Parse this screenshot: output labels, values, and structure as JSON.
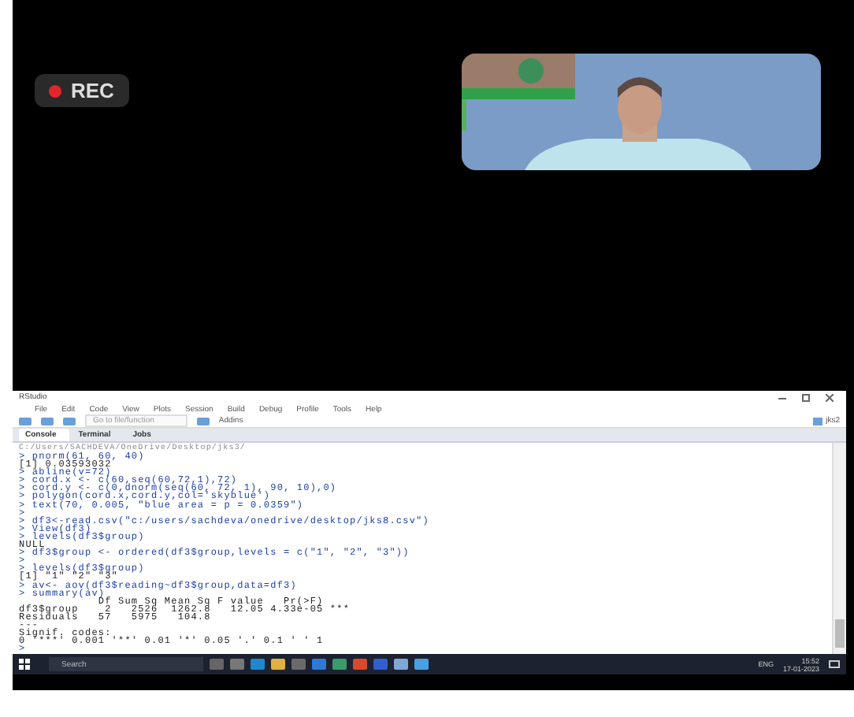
{
  "recording": {
    "label": "REC"
  },
  "shared_screen": {
    "window_title": "RStudio",
    "menu": [
      "File",
      "Edit",
      "Code",
      "View",
      "Plots",
      "Session",
      "Build",
      "Debug",
      "Profile",
      "Tools",
      "Help"
    ],
    "toolbar": {
      "goto_placeholder": "Go to file/function",
      "addins": "Addins",
      "project": "jks2"
    },
    "tabs": [
      {
        "label": "Console",
        "selected": true
      },
      {
        "label": "Terminal",
        "selected": false
      },
      {
        "label": "Jobs",
        "selected": false
      }
    ],
    "console_path": "C:/Users/SACHDEVA/OneDrive/Desktop/jks3/",
    "console_lines": [
      {
        "kind": "input",
        "text": "> pnorm(61, 60, 40)"
      },
      {
        "kind": "output",
        "text": "[1] 0.03593032"
      },
      {
        "kind": "input",
        "text": "> abline(v=72)"
      },
      {
        "kind": "input",
        "text": "> cord.x <- c(60,seq(60,72,1),72)"
      },
      {
        "kind": "input",
        "text": "> cord.y <- c(0,dnorm(seq(60, 72, 1), 90, 10),0)"
      },
      {
        "kind": "input",
        "text": "> polygon(cord.x,cord.y,col='skyblue')"
      },
      {
        "kind": "input",
        "text": "> text(70, 0.005, \"blue area = p = 0.0359\")"
      },
      {
        "kind": "input",
        "text": ">"
      },
      {
        "kind": "input",
        "text": "> df3<-read.csv(\"c:/users/sachdeva/onedrive/desktop/jks8.csv\")"
      },
      {
        "kind": "input",
        "text": "> View(df3)"
      },
      {
        "kind": "input",
        "text": "> levels(df3$group)"
      },
      {
        "kind": "output",
        "text": "NULL"
      },
      {
        "kind": "input",
        "text": "> df3$group <- ordered(df3$group,levels = c(\"1\", \"2\", \"3\"))"
      },
      {
        "kind": "input",
        "text": ">"
      },
      {
        "kind": "input",
        "text": "> levels(df3$group)"
      },
      {
        "kind": "output",
        "text": "[1] \"1\" \"2\" \"3\""
      },
      {
        "kind": "input",
        "text": "> av<- aov(df3$reading~df3$group,data=df3)"
      },
      {
        "kind": "input",
        "text": "> summary(av)"
      },
      {
        "kind": "output",
        "text": "            Df Sum Sq Mean Sq F value   Pr(>F)"
      },
      {
        "kind": "output",
        "text": "df3$group    2   2526  1262.8   12.05 4.33e-05 ***"
      },
      {
        "kind": "output",
        "text": "Residuals   57   5975   104.8"
      },
      {
        "kind": "output",
        "text": "---"
      },
      {
        "kind": "output",
        "text": "Signif. codes:"
      },
      {
        "kind": "output",
        "text": "0 '***' 0.001 '**' 0.01 '*' 0.05 '.' 0.1 ' ' 1"
      },
      {
        "kind": "input",
        "text": ">"
      }
    ],
    "taskbar": {
      "search_placeholder": "Search",
      "language": "ENG",
      "time": "15:52",
      "date": "17-01-2023"
    }
  }
}
